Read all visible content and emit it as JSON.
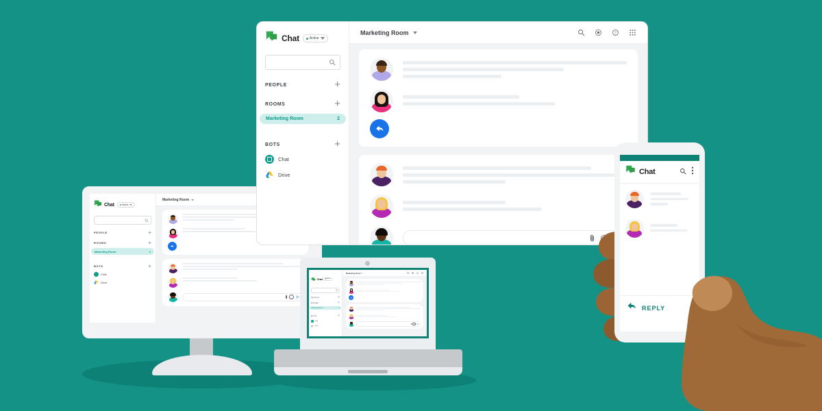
{
  "scene": {
    "background_color": "#159286",
    "shadow_color": "#0d8176",
    "description": "Google Chat marketing illustration on teal background showing the app on desktop, monitor, laptop and a phone held in a hand"
  },
  "brand": {
    "name": "Chat",
    "logo_color": "#34a853",
    "accent_teal": "#0f9d8e",
    "accent_blue": "#1a73e8"
  },
  "desktop": {
    "sidebar": {
      "brand_label": "Chat",
      "status_pill": "Active",
      "search_placeholder": "",
      "search_value": "",
      "sections": [
        {
          "label": "PEOPLE",
          "add_label": "+"
        },
        {
          "label": "ROOMS",
          "add_label": "+"
        },
        {
          "label": "BOTS",
          "add_label": "+"
        }
      ],
      "rooms": [
        {
          "name": "Marketing Room",
          "badge": "2",
          "selected": true
        }
      ],
      "bots": [
        {
          "name": "Chat",
          "icon": "chat-bot-icon"
        },
        {
          "name": "Drive",
          "icon": "drive-bot-icon"
        }
      ]
    },
    "topbar": {
      "room_title": "Marketing Room",
      "tools": [
        {
          "name": "search-icon",
          "glyph": "search"
        },
        {
          "name": "settings-icon",
          "glyph": "gear"
        },
        {
          "name": "help-icon",
          "glyph": "question"
        },
        {
          "name": "apps-grid-icon",
          "glyph": "grid"
        }
      ]
    },
    "threads": [
      {
        "messages": [
          {
            "avatar": "avatar-brown-lavender",
            "lines": [
              100,
              72,
              44
            ]
          },
          {
            "avatar": "avatar-black-hair-pink",
            "lines": [
              52,
              68
            ]
          }
        ],
        "reply_button": "reply-arrow-icon"
      },
      {
        "messages": [
          {
            "avatar": "avatar-red-hair-purple",
            "lines": [
              84,
              100,
              46
            ]
          },
          {
            "avatar": "avatar-blonde-magenta",
            "lines": [
              46,
              62
            ]
          },
          {
            "avatar": "avatar-dark-teal",
            "lines": []
          }
        ],
        "composer": {
          "placeholder": "",
          "value": "",
          "icons": [
            {
              "name": "attach-icon",
              "glyph": "paperclip"
            },
            {
              "name": "emoji-icon",
              "glyph": "smiley"
            },
            {
              "name": "send-icon",
              "glyph": "send"
            }
          ]
        }
      }
    ]
  },
  "phone": {
    "header": {
      "brand_label": "Chat",
      "search_icon": "search-icon",
      "overflow_icon": "more-vertical-icon"
    },
    "messages": [
      {
        "avatar": "avatar-red-hair-purple",
        "lines": [
          70,
          88,
          40
        ]
      },
      {
        "avatar": "avatar-blonde-magenta",
        "lines": [
          62,
          84
        ]
      }
    ],
    "reply_label": "REPLY",
    "reply_icon": "reply-arrow-icon"
  },
  "monitor": {
    "mirrors": "desktop"
  },
  "laptop": {
    "mirrors": "desktop"
  }
}
